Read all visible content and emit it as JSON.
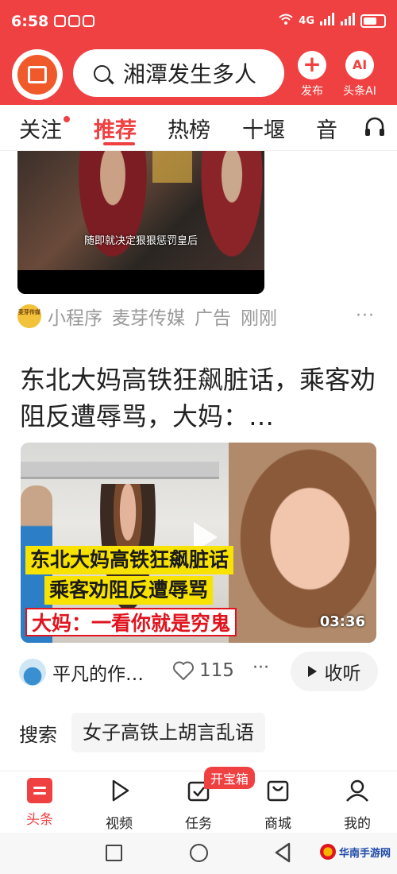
{
  "status_bar": {
    "time": "6:58",
    "network": "4G"
  },
  "header": {
    "search_query": "湘潭发生多人",
    "publish_label": "发布",
    "publish_icon": "+",
    "ai_label": "头条AI",
    "ai_icon_text": "AI"
  },
  "tabs": [
    {
      "label": "关注",
      "dot": true
    },
    {
      "label": "推荐",
      "active": true
    },
    {
      "label": "热榜"
    },
    {
      "label": "十堰"
    },
    {
      "label": "音"
    }
  ],
  "feed": {
    "item1": {
      "subtitle": "随即就决定狠狠惩罚皇后",
      "avatar_text": "麦芽传媒",
      "meta": [
        "小程序",
        "麦芽传媒",
        "广告",
        "刚刚"
      ],
      "more": "···"
    },
    "item2": {
      "title": "东北大妈高铁狂飙脏话，乘客劝阻反遭辱骂，大妈：…",
      "caption_line1": "东北大妈高铁狂飙脏话",
      "caption_line2": "乘客劝阻反遭辱骂",
      "caption_line3": "大妈：一看你就是穷鬼",
      "duration": "03:36",
      "author": "平凡的作…",
      "likes": "115",
      "more": "···",
      "listen_label": "收听"
    },
    "related": {
      "label": "搜索",
      "query": "女子高铁上胡言乱语"
    }
  },
  "bottom_nav": {
    "items": [
      {
        "label": "头条",
        "icon": "home-icon",
        "active": true
      },
      {
        "label": "视频",
        "icon": "play-icon"
      },
      {
        "label": "任务",
        "icon": "task-icon"
      },
      {
        "label": "商城",
        "icon": "shop-icon"
      },
      {
        "label": "我的",
        "icon": "profile-icon"
      }
    ],
    "treasure_badge": "开宝箱"
  },
  "watermark": "华南手游网",
  "colors": {
    "brand": "#f04142",
    "caption_yellow": "#f7e200"
  }
}
